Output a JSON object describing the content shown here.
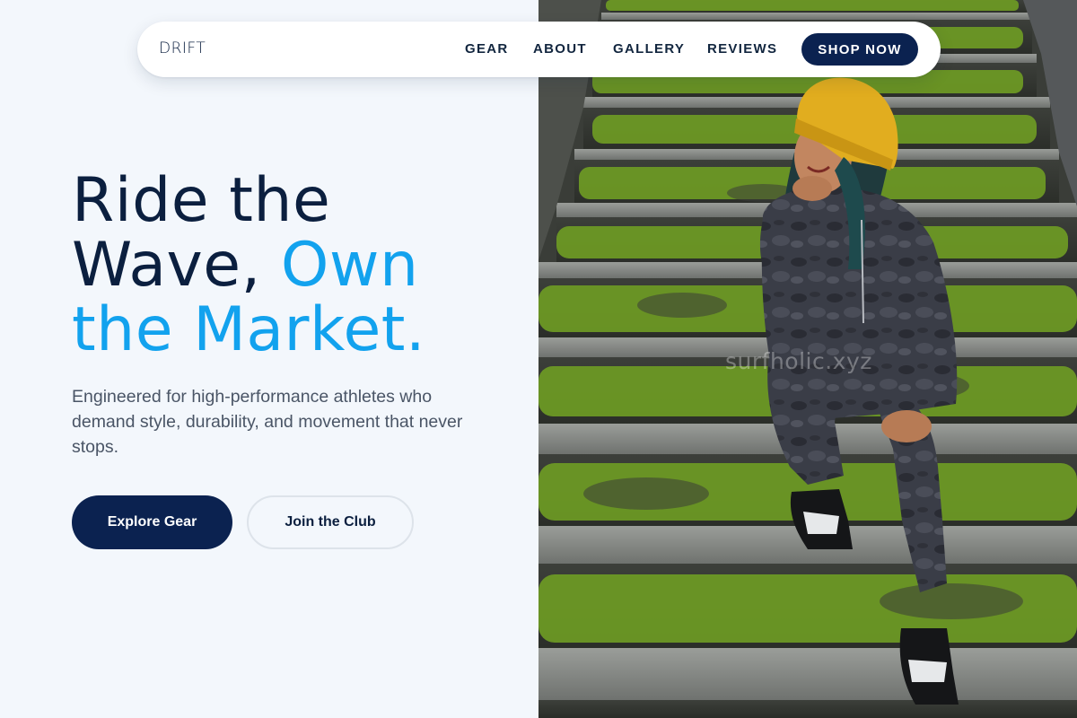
{
  "brand": {
    "logo": "DRIFT"
  },
  "nav": {
    "links": [
      "GEAR",
      "ABOUT",
      "GALLERY",
      "REVIEWS"
    ],
    "cta": "SHOP NOW"
  },
  "hero": {
    "headline_line1": "Ride the",
    "headline_line2_a": "Wave, ",
    "headline_line2_b": "Own",
    "headline_line3": "the Market.",
    "subtitle": "Engineered for high-performance athletes who demand style, durability, and movement that never stops.",
    "primary_button": "Explore Gear",
    "secondary_button": "Join the Club",
    "image_watermark": "surfholic.xyz"
  },
  "colors": {
    "navy": "#0b2250",
    "accent": "#12a2ee",
    "background": "#f3f7fc",
    "moss": "#6f9a25",
    "beanie": "#e1ad1f"
  }
}
